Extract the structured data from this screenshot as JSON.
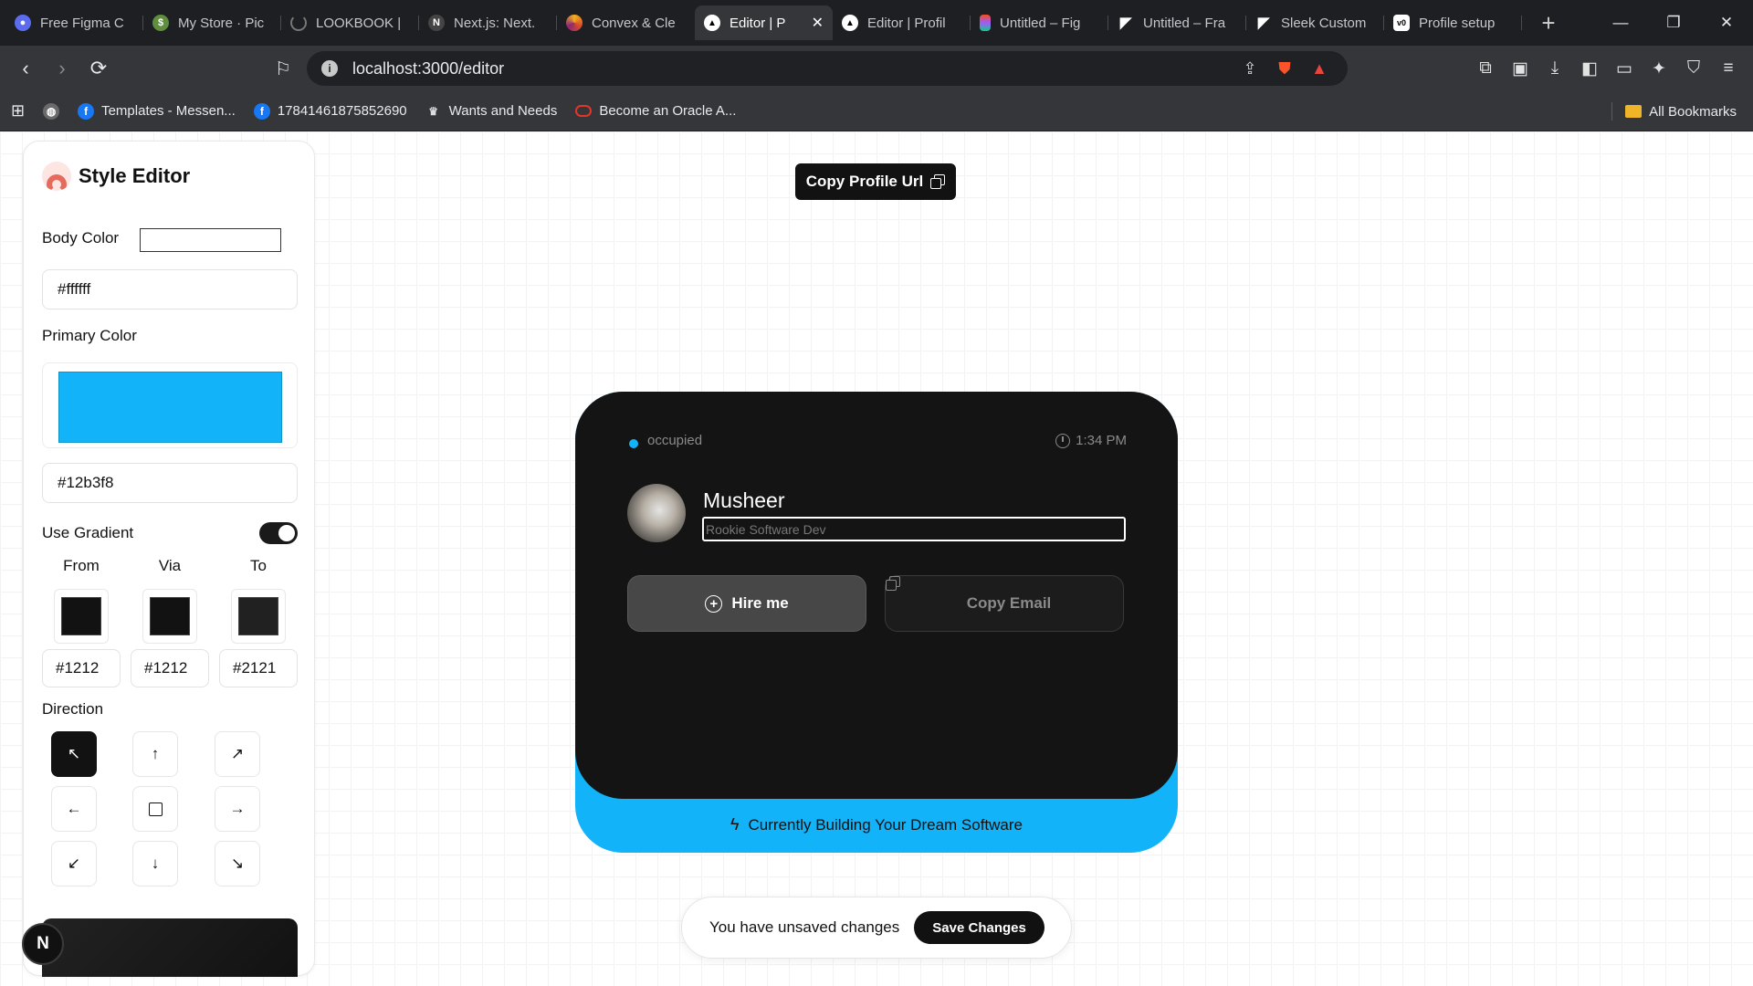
{
  "browser": {
    "tabs": [
      {
        "label": "Free Figma C",
        "icon": "figma-community-icon",
        "color": "#5b6cf0"
      },
      {
        "label": "My Store · Pic",
        "icon": "shopify-icon",
        "color": "#5e8e3e"
      },
      {
        "label": "LOOKBOOK |",
        "icon": "loading-spinner-icon",
        "color": "#666666"
      },
      {
        "label": "Next.js: Next.",
        "icon": "nextjs-icon",
        "color": "#444444"
      },
      {
        "label": "Convex & Cle",
        "icon": "convex-icon",
        "color": "#d94a2a"
      },
      {
        "label": "Editor | P",
        "icon": "vercel-triangle-icon",
        "color": "#000000",
        "active": true
      },
      {
        "label": "Editor | Profil",
        "icon": "vercel-triangle-icon",
        "color": "#000000"
      },
      {
        "label": "Untitled – Fig",
        "icon": "figma-icon",
        "color": "#f24e1e"
      },
      {
        "label": "Untitled – Fra",
        "icon": "framer-icon",
        "color": "#333333"
      },
      {
        "label": "Sleek Custom",
        "icon": "framer-icon",
        "color": "#333333"
      },
      {
        "label": "Profile setup",
        "icon": "v0-icon",
        "color": "#ffffff"
      }
    ],
    "url": "localhost:3000/editor",
    "bookmarks": [
      {
        "label": "Templates - Messen...",
        "icon": "facebook-icon",
        "color": "#1877f2"
      },
      {
        "label": "17841461875852690",
        "icon": "facebook-icon",
        "color": "#1877f2"
      },
      {
        "label": "Wants and Needs",
        "icon": "crown-icon",
        "color": "#dddddd"
      },
      {
        "label": "Become an Oracle A...",
        "icon": "oracle-icon",
        "color": "#e2362a"
      }
    ],
    "all_bookmarks": "All Bookmarks"
  },
  "editor": {
    "title": "Style Editor",
    "body_color_label": "Body Color",
    "body_color_value": "#ffffff",
    "primary_color_label": "Primary Color",
    "primary_color_value": "#12b3f8",
    "use_gradient_label": "Use Gradient",
    "use_gradient": true,
    "gradient": {
      "from_label": "From",
      "from_value": "#1212",
      "via_label": "Via",
      "via_value": "#1212",
      "to_label": "To",
      "to_value": "#2121"
    },
    "direction_label": "Direction",
    "direction_selected": "top-left",
    "nav_badge": "N"
  },
  "toolbar": {
    "copy_profile_url": "Copy Profile Url"
  },
  "card": {
    "status": "occupied",
    "time": "1:34 PM",
    "name": "Musheer",
    "role": "Rookie Software Dev",
    "hire_label": "Hire me",
    "copy_email_label": "Copy Email",
    "footer_text": "Currently Building Your Dream Software"
  },
  "unsaved": {
    "message": "You have unsaved changes",
    "save_label": "Save Changes"
  }
}
